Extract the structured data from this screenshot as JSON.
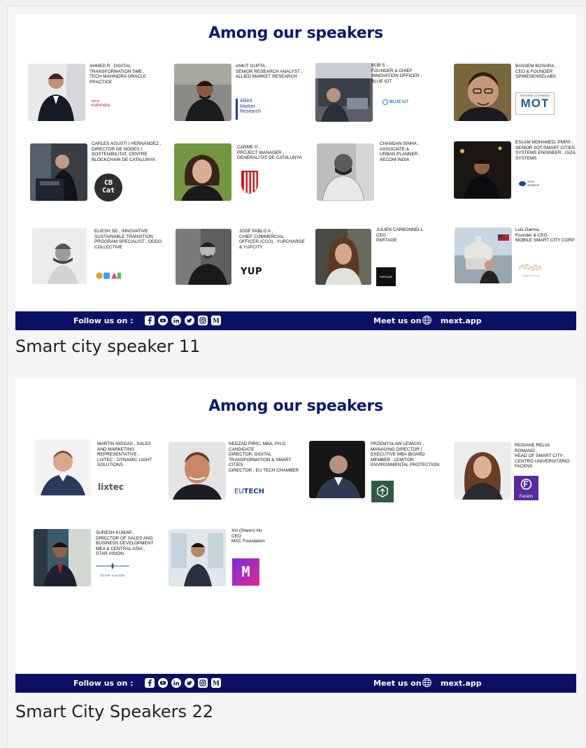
{
  "sections": [
    {
      "title": "Among our speakers",
      "caption": "Smart city speaker 11",
      "follow_label": "Follow us on :",
      "meet_label": "Meet us on",
      "site_label": "mext.app",
      "speakers": [
        {
          "lines": [
            "AHMED R , DIGITAL",
            "TRANSFORMATION SME ,",
            "TECH MAHINDRA ORACLE",
            "PRACTICE"
          ],
          "logo_text": [
            "TECH",
            "mahindra"
          ]
        },
        {
          "lines": [
            "ANKIT GUPTA ,",
            "SENIOR RESEARCH ANALYST ,",
            "ALLIED MARKET RESEARCH"
          ],
          "logo_text": [
            "Allied",
            "Market",
            "Research"
          ]
        },
        {
          "lines": [
            "BOB S ,",
            "FOUNDER & CHIEF",
            "INNOVATION OFFICER ,",
            "BLUE IOT"
          ],
          "logo_text": [
            "BLUE IoT"
          ]
        },
        {
          "lines": [
            "BASSEM BOSHRA ,",
            "CEO & FOUNDER",
            "SPIMESENSELABS"
          ],
          "logo_text": [
            "MASTER of THINGS",
            "MOT"
          ]
        },
        {
          "lines": [
            "CARLES AGUSTI I HERNÀNDEZ ,",
            "DIRECTOR DE NODES I",
            "SOSTENIBILITAT, CENTRE",
            "BLOCKCHAIN DE CATALUNYA"
          ],
          "logo_text": [
            "CB",
            "Cat"
          ]
        },
        {
          "lines": [
            "CARME G ,",
            "PROJECT MANAGER ,",
            "GENERALITAT DE CATALUNYA"
          ],
          "logo_text": []
        },
        {
          "lines": [
            "CHANDAN SINHA ,",
            "ASSOCIATE &",
            "URBAN PLANNER ,",
            "AECOM INDIA"
          ],
          "logo_text": []
        },
        {
          "lines": [
            "ESLAM MOHAMED, PMP® ,",
            "SENIOR IIOT/SMART CITIES",
            "SYSTEMS ENGINEER , GIZA",
            "SYSTEMS"
          ],
          "logo_text": [
            "Giza",
            "Systems"
          ]
        },
        {
          "lines": [
            "ELIESH SD , INNOVATIVE",
            "SUSTAINABLE TRANSITION",
            "PROGRAM SPECIALIST , ODDO",
            "COLLECTIVE"
          ],
          "logo_text": []
        },
        {
          "lines": [
            "JOSE PABLO A ,",
            "CHIEF COMMERCIAL",
            "OFFICER (CCO) , YUPCHARGE",
            "& YUPCITY"
          ],
          "logo_text": [
            "yuP"
          ]
        },
        {
          "lines": [
            "JULIEN CARBONNELL",
            "CEO",
            "PARTAGE"
          ],
          "logo_text": [
            "PARTAGE"
          ]
        },
        {
          "lines": [
            "Luis Garma,",
            "Founder & CEO",
            "MOBILE SMART CITY CORP"
          ],
          "logo_text": [
            "Mobile Smart City"
          ]
        }
      ]
    },
    {
      "title": "Among our speakers",
      "caption": "Smart City Speakers 22",
      "follow_label": "Follow us on :",
      "meet_label": "Meet us on",
      "site_label": "mext.app",
      "speakers": [
        {
          "lines": [
            "MARTIN NIGGAS , SALES",
            "AND MARKETING",
            "REPRESENTATIVE ,",
            "LIXTEC - DYNAMIC LIGHT",
            "SOLUTIONS"
          ],
          "logo_text": [
            "lixtec"
          ]
        },
        {
          "lines": [
            "NEDZAD PIRIC, MBA, PH.D",
            "CANDIDATE",
            "DIRECTOR, DIGITAL",
            "TRANSFORMATION & SMART CITIES",
            "DIRECTOR , EU TECH CHAMBER"
          ],
          "logo_text": [
            "EU",
            "TECH"
          ]
        },
        {
          "lines": [
            "PRZEMYSLAW LEWICKI ,",
            "MANAGING DIRECTOR |",
            "EXECUTIVE MBA |BOARD",
            "MEMBER , LEMITOR",
            "ENVIRONMENTAL PROTECTION"
          ],
          "logo_text": []
        },
        {
          "lines": [
            "REGIANE RELVA",
            "ROMANO ,",
            "HEAD OF SMART CITY ,",
            "CENTRO UNIVERSITÁRIO",
            "FACENS"
          ],
          "logo_text": [
            "Facens"
          ]
        },
        {
          "lines": [
            "SURESH KUMAR ,",
            "DIRECTOR OF SALES AND",
            "BUSINESS DEVELOPMENT",
            "MEA & CENTRAL ASIA ,",
            "STAR.VISION"
          ],
          "logo_text": [
            "STAR·VISION"
          ]
        },
        {
          "lines": [
            "Xin (Sheen) Hu",
            "CEO",
            "MXC Foundation"
          ],
          "logo_text": [
            "M"
          ]
        }
      ]
    }
  ],
  "icons": [
    "facebook-icon",
    "youtube-icon",
    "linkedin-icon",
    "twitter-icon",
    "instagram-icon",
    "medium-icon",
    "globe-icon"
  ],
  "colors": {
    "brand_navy": "#0a1164",
    "title_navy": "#0d1b6b"
  }
}
